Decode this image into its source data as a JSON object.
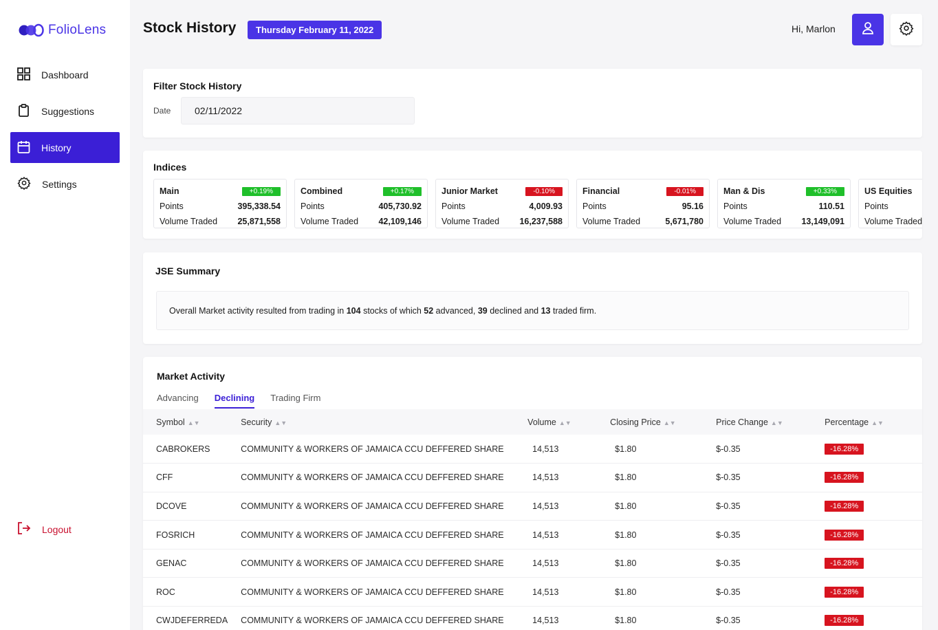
{
  "sidebar": {
    "logo_text": "FolioLens",
    "items": [
      {
        "label": "Dashboard",
        "icon": "grid-icon"
      },
      {
        "label": "Suggestions",
        "icon": "clipboard-icon"
      },
      {
        "label": "History",
        "icon": "calendar-icon",
        "active": true
      },
      {
        "label": "Settings",
        "icon": "gear-icon"
      }
    ],
    "logout_label": "Logout"
  },
  "header": {
    "title": "Stock History",
    "date_badge": "Thursday February 11, 2022",
    "greeting": "Hi, Marlon"
  },
  "filter": {
    "title": "Filter Stock History",
    "date_label": "Date",
    "date_value": "02/11/2022"
  },
  "indices": {
    "title": "Indices",
    "points_label": "Points",
    "volume_label": "Volume Traded",
    "items": [
      {
        "name": "Main",
        "change": "+0.19%",
        "direction": "up",
        "points": "395,338.54",
        "volume": "25,871,558"
      },
      {
        "name": "Combined",
        "change": "+0.17%",
        "direction": "up",
        "points": "405,730.92",
        "volume": "42,109,146"
      },
      {
        "name": "Junior Market",
        "change": "-0.10%",
        "direction": "down",
        "points": "4,009.93",
        "volume": "16,237,588"
      },
      {
        "name": "Financial",
        "change": "-0.01%",
        "direction": "down",
        "points": "95.16",
        "volume": "5,671,780"
      },
      {
        "name": "Man & Dis",
        "change": "+0.33%",
        "direction": "up",
        "points": "110.51",
        "volume": "13,149,091"
      },
      {
        "name": "US Equities",
        "change": "",
        "direction": "up",
        "points": "",
        "volume": ""
      }
    ]
  },
  "jse_summary": {
    "title": "JSE Summary",
    "text_prefix": "Overall Market activity resulted from trading in ",
    "total": "104",
    "text_mid1": " stocks of which ",
    "advanced": "52",
    "text_mid2": " advanced, ",
    "declined": "39",
    "text_mid3": " declined and ",
    "firm": "13",
    "text_suffix": " traded firm."
  },
  "market_activity": {
    "title": "Market Activity",
    "tabs": [
      "Advancing",
      "Declining",
      "Trading Firm"
    ],
    "active_tab": "Declining",
    "columns": [
      "Symbol",
      "Security",
      "Volume",
      "Closing Price",
      "Price Change",
      "Percentage"
    ],
    "rows": [
      {
        "symbol": "CABROKERS",
        "security": "COMMUNITY & WORKERS OF JAMAICA CCU DEFFERED SHARE",
        "volume": "14,513",
        "closing_price": "$1.80",
        "price_change": "$-0.35",
        "percentage": "-16.28%"
      },
      {
        "symbol": "CFF",
        "security": "COMMUNITY & WORKERS OF JAMAICA CCU DEFFERED SHARE",
        "volume": "14,513",
        "closing_price": "$1.80",
        "price_change": "$-0.35",
        "percentage": "-16.28%"
      },
      {
        "symbol": "DCOVE",
        "security": "COMMUNITY & WORKERS OF JAMAICA CCU DEFFERED SHARE",
        "volume": "14,513",
        "closing_price": "$1.80",
        "price_change": "$-0.35",
        "percentage": "-16.28%"
      },
      {
        "symbol": "FOSRICH",
        "security": "COMMUNITY & WORKERS OF JAMAICA CCU DEFFERED SHARE",
        "volume": "14,513",
        "closing_price": "$1.80",
        "price_change": "$-0.35",
        "percentage": "-16.28%"
      },
      {
        "symbol": "GENAC",
        "security": "COMMUNITY & WORKERS OF JAMAICA CCU DEFFERED SHARE",
        "volume": "14,513",
        "closing_price": "$1.80",
        "price_change": "$-0.35",
        "percentage": "-16.28%"
      },
      {
        "symbol": "ROC",
        "security": "COMMUNITY & WORKERS OF JAMAICA CCU DEFFERED SHARE",
        "volume": "14,513",
        "closing_price": "$1.80",
        "price_change": "$-0.35",
        "percentage": "-16.28%"
      },
      {
        "symbol": "CWJDEFERREDA",
        "security": "COMMUNITY & WORKERS OF JAMAICA CCU DEFFERED SHARE",
        "volume": "14,513",
        "closing_price": "$1.80",
        "price_change": "$-0.35",
        "percentage": "-16.28%"
      }
    ]
  },
  "colors": {
    "accent": "#4a34e6",
    "active_nav": "#3b1fd6",
    "up": "#1fbf2a",
    "down": "#d7141f",
    "logout": "#c8102e"
  }
}
